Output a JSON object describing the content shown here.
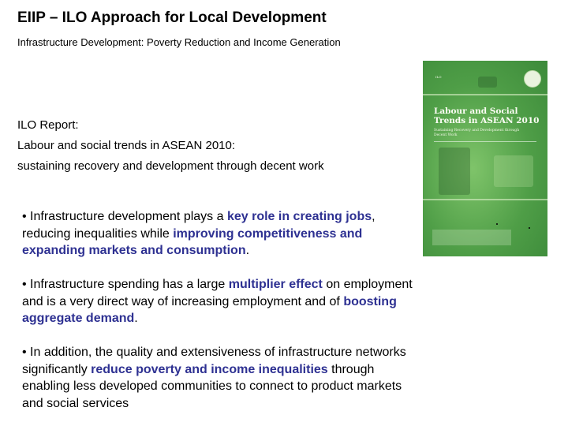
{
  "slide": {
    "title": "EIIP – ILO Approach for Local Development",
    "subtitle": "Infrastructure Development: Poverty Reduction and Income Generation",
    "report_lines": [
      "ILO Report:",
      "Labour and social trends in ASEAN 2010:",
      "sustaining recovery and development through decent work"
    ],
    "bullets": [
      {
        "p1": "• Infrastructure development plays a ",
        "h1": "key role in creating jobs",
        "p2": ", reducing inequalities while ",
        "h2": "improving competitiveness and expanding markets and consumption",
        "p3": "."
      },
      {
        "p1": "• Infrastructure spending has a large ",
        "h1": "multiplier effect",
        "p2": " on employment and is a very direct way of increasing employment and of ",
        "h2": "boosting aggregate demand",
        "p3": "."
      },
      {
        "p1": "• In addition, the quality and extensiveness of infrastructure networks significantly ",
        "h1": "reduce poverty and income inequalities",
        "p2": " through enabling less developed communities to connect to product markets and social services"
      }
    ],
    "cover": {
      "title": "Labour and Social Trends in ASEAN 2010",
      "subtitle": "Sustaining Recovery and Development through Decent Work"
    }
  },
  "colors": {
    "highlight": "#2e3192",
    "cover_green": "#4f9e47"
  }
}
